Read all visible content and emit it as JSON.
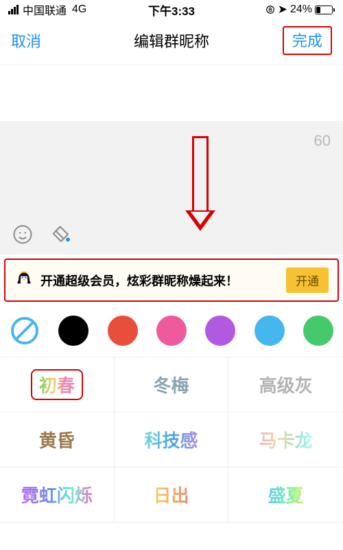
{
  "status": {
    "carrier": "中国联通",
    "network": "4G",
    "time": "下午3:33",
    "battery_pct": "24%"
  },
  "nav": {
    "cancel": "取消",
    "title": "编辑群昵称",
    "done": "完成"
  },
  "input": {
    "counter": "60"
  },
  "promo": {
    "text": "开通超级会员，炫彩群昵称燥起来！",
    "action": "开通"
  },
  "colors": {
    "none": "none",
    "items": [
      "#000000",
      "#e94e3c",
      "#ef5a9c",
      "#b25adf",
      "#46b6ef",
      "#44c96b"
    ]
  },
  "styles": {
    "items": [
      {
        "key": "chuchun",
        "label": "初春"
      },
      {
        "key": "dongmei",
        "label": "冬梅"
      },
      {
        "key": "gaoji",
        "label": "高级灰"
      },
      {
        "key": "huanghun",
        "label": "黄昏"
      },
      {
        "key": "keji",
        "label": "科技感"
      },
      {
        "key": "makalong",
        "label": "马卡龙"
      },
      {
        "key": "neon",
        "label": "霓虹闪烁"
      },
      {
        "key": "richu",
        "label": "日出"
      },
      {
        "key": "shengxia",
        "label": "盛夏"
      }
    ],
    "selected": "chuchun"
  }
}
